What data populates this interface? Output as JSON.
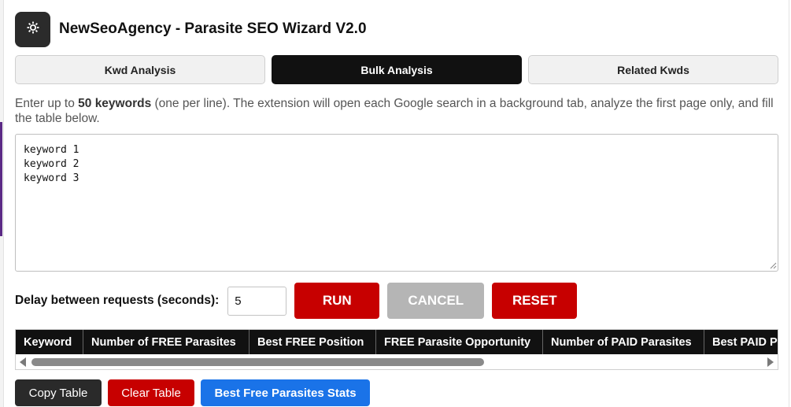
{
  "header": {
    "title": "NewSeoAgency - Parasite SEO Wizard V2.0",
    "logo_icon": "gear-icon"
  },
  "tabs": [
    {
      "label": "Kwd Analysis",
      "active": false
    },
    {
      "label": "Bulk Analysis",
      "active": true
    },
    {
      "label": "Related Kwds",
      "active": false
    }
  ],
  "description": {
    "prefix": "Enter up to ",
    "bold": "50 keywords",
    "suffix": " (one per line). The extension will open each Google search in a background tab, analyze the first page only, and fill the table below."
  },
  "keywords_input": {
    "value": "keyword 1\nkeyword 2\nkeyword 3"
  },
  "controls": {
    "delay_label": "Delay between requests (seconds):",
    "delay_value": "5",
    "run_label": "RUN",
    "cancel_label": "CANCEL",
    "reset_label": "RESET"
  },
  "table": {
    "columns": [
      "Keyword",
      "Number of FREE Parasites",
      "Best FREE Position",
      "FREE Parasite Opportunity",
      "Number of PAID Parasites",
      "Best PAID Position"
    ]
  },
  "bottom_buttons": {
    "copy_label": "Copy Table",
    "clear_label": "Clear Table",
    "stats_label": "Best Free Parasites Stats"
  },
  "colors": {
    "run": "#c70000",
    "reset": "#c70000",
    "cancel": "#b5b5b5",
    "stats": "#1a73e8",
    "active_tab": "#111111"
  }
}
